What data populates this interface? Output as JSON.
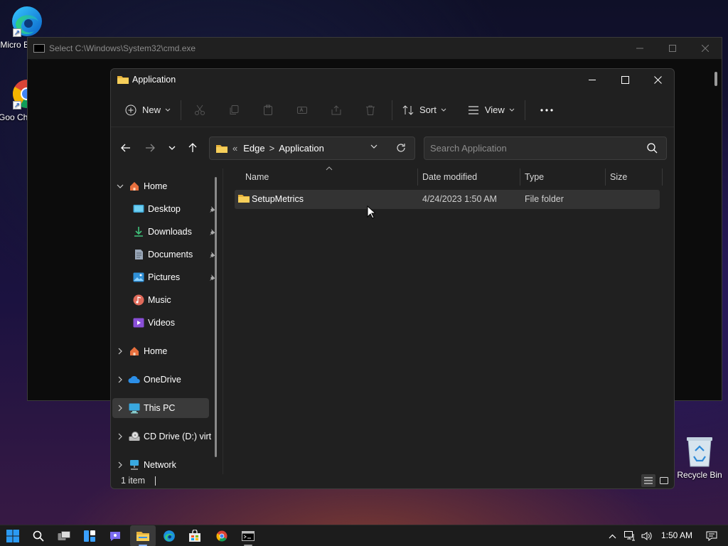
{
  "desktop": {
    "icons": [
      {
        "label": "Micro Ed",
        "icon": "edge-icon"
      },
      {
        "label": "Goo Chro",
        "icon": "chrome-icon"
      }
    ],
    "recycle_bin": {
      "label": "Recycle Bin",
      "icon": "recycle-bin-icon"
    }
  },
  "cmd_window": {
    "title": "Select C:\\Windows\\System32\\cmd.exe"
  },
  "explorer": {
    "title": "Application",
    "command_bar": {
      "new_label": "New",
      "sort_label": "Sort",
      "view_label": "View",
      "icons": [
        "cut-icon",
        "copy-icon",
        "paste-icon",
        "rename-icon",
        "share-icon",
        "delete-icon"
      ]
    },
    "address": {
      "overflow": "«",
      "crumbs": [
        "Edge",
        "Application"
      ],
      "separator": ">"
    },
    "search": {
      "placeholder": "Search Application"
    },
    "nav_pane": {
      "items": [
        {
          "label": "Home",
          "icon": "home-icon",
          "expander": "expanded"
        },
        {
          "label": "Desktop",
          "icon": "desktop-icon",
          "pinned": true
        },
        {
          "label": "Downloads",
          "icon": "downloads-icon",
          "pinned": true
        },
        {
          "label": "Documents",
          "icon": "documents-icon",
          "pinned": true
        },
        {
          "label": "Pictures",
          "icon": "pictures-icon",
          "pinned": true
        },
        {
          "label": "Music",
          "icon": "music-icon"
        },
        {
          "label": "Videos",
          "icon": "videos-icon"
        },
        {
          "label": "Home",
          "icon": "home-icon",
          "expander": "collapsed"
        },
        {
          "label": "OneDrive",
          "icon": "onedrive-icon",
          "expander": "collapsed"
        },
        {
          "label": "This PC",
          "icon": "this-pc-icon",
          "expander": "collapsed",
          "selected": true
        },
        {
          "label": "CD Drive (D:) virt",
          "icon": "cd-drive-icon",
          "expander": "collapsed"
        },
        {
          "label": "Network",
          "icon": "network-icon",
          "expander": "collapsed"
        }
      ]
    },
    "columns": [
      "Name",
      "Date modified",
      "Type",
      "Size"
    ],
    "files": [
      {
        "name": "SetupMetrics",
        "date_modified": "4/24/2023 1:50 AM",
        "type": "File folder",
        "size": ""
      }
    ],
    "status": {
      "item_count": "1 item"
    }
  },
  "taskbar": {
    "apps": [
      "start-icon",
      "search-icon",
      "task-view-icon",
      "widgets-icon",
      "chat-icon",
      "file-explorer-icon",
      "edge-icon",
      "store-icon",
      "chrome-icon",
      "cmd-icon"
    ],
    "active_app": "file-explorer-icon",
    "clock": "1:50 AM"
  },
  "colors": {
    "explorer_bg": "#202020",
    "selection": "#333333",
    "accent": "#0078d4",
    "folder_yellow": "#f5c542"
  }
}
